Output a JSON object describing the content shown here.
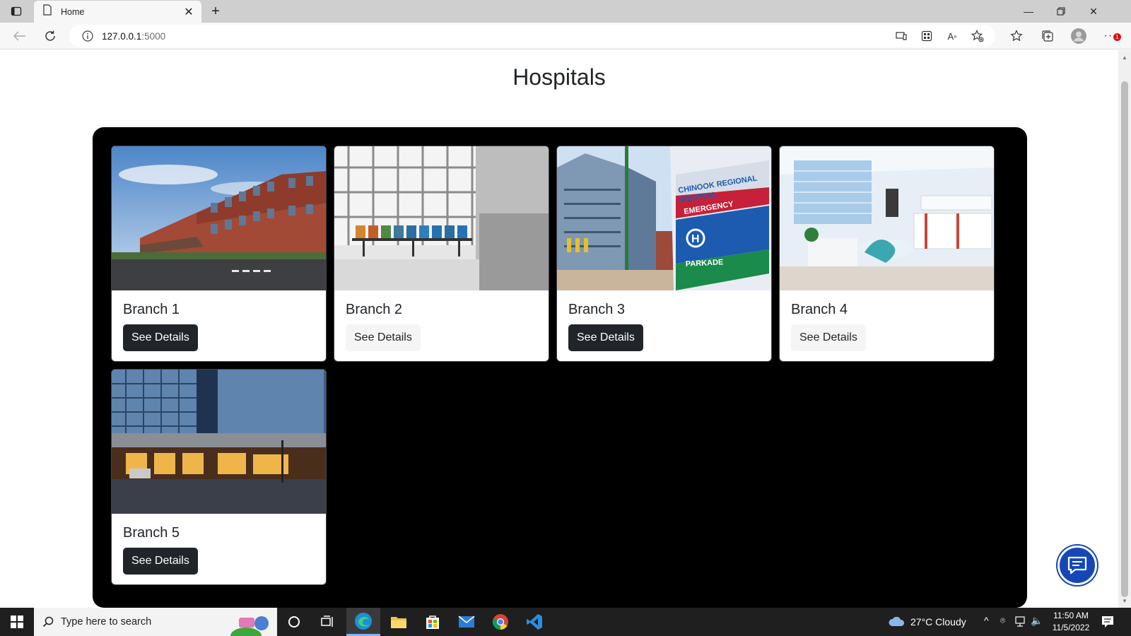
{
  "browser": {
    "tab_title": "Home",
    "url_host": "127.0.0.1",
    "url_port": ":5000"
  },
  "page": {
    "title": "Hospitals",
    "cards": [
      {
        "title": "Branch 1",
        "button": "See Details",
        "button_style": "dark"
      },
      {
        "title": "Branch 2",
        "button": "See Details",
        "button_style": "light"
      },
      {
        "title": "Branch 3",
        "button": "See Details",
        "button_style": "dark"
      },
      {
        "title": "Branch 4",
        "button": "See Details",
        "button_style": "light"
      },
      {
        "title": "Branch 5",
        "button": "See Details",
        "button_style": "dark"
      }
    ],
    "sign_text": {
      "line1": "CHINOOK REGIONAL",
      "line2": "HOSPITAL",
      "line3": "EMERGENCY",
      "line4": "PARKADE"
    }
  },
  "taskbar": {
    "search_placeholder": "Type here to search",
    "weather": "27°C  Cloudy",
    "time": "11:50 AM",
    "date": "11/5/2022"
  },
  "colors": {
    "panel_bg": "#000000",
    "btn_dark": "#212529",
    "btn_light": "#f5f5f5",
    "chat_button": "#1547b8"
  }
}
